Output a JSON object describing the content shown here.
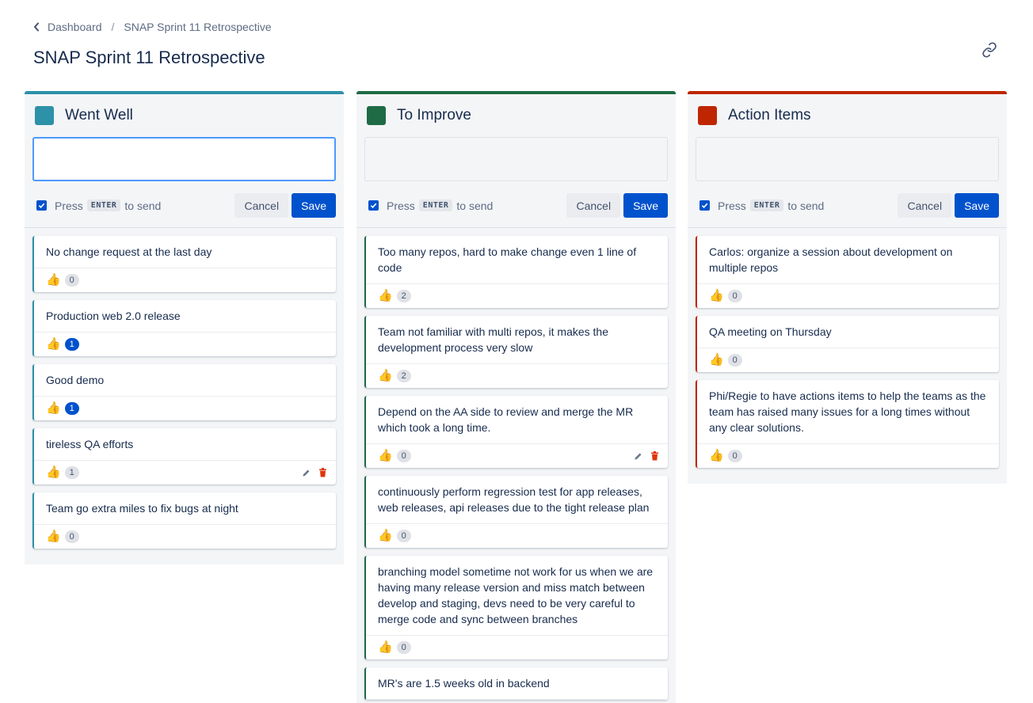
{
  "breadcrumb": {
    "parent": "Dashboard",
    "separator": "/",
    "current": "SNAP Sprint 11 Retrospective"
  },
  "page": {
    "title": "SNAP Sprint 11 Retrospective"
  },
  "composer": {
    "press": "Press",
    "key": "ENTER",
    "to_send": "to send",
    "cancel": "Cancel",
    "save": "Save"
  },
  "columns": [
    {
      "title": "Went Well",
      "color": "#2d91a8",
      "cards": [
        {
          "text": "No change request at the last day",
          "votes": "0"
        },
        {
          "text": "Production web 2.0 release",
          "votes": "1"
        },
        {
          "text": "Good demo",
          "votes": "1"
        },
        {
          "text": "tireless QA efforts",
          "votes": "1"
        },
        {
          "text": "Team go extra miles to fix bugs at night",
          "votes": "0"
        }
      ]
    },
    {
      "title": "To Improve",
      "color": "#1f6b45",
      "cards": [
        {
          "text": "Too many repos, hard to make change even 1 line of code",
          "votes": "2"
        },
        {
          "text": "Team not familiar with multi repos, it makes the development process very slow",
          "votes": "2"
        },
        {
          "text": "Depend on the AA side to review and merge the MR which took a long time.",
          "votes": "0"
        },
        {
          "text": "continuously perform regression test for app releases, web releases, api releases due to the tight release plan",
          "votes": "0"
        },
        {
          "text": "branching model sometime not work for us when we are having many release version and miss match between develop and staging, devs need to be very careful to merge code and sync between branches",
          "votes": "0"
        },
        {
          "text": "MR's are 1.5 weeks old in backend",
          "votes": ""
        }
      ]
    },
    {
      "title": "Action Items",
      "color": "#bf2600",
      "cards": [
        {
          "text": "Carlos: organize a session about development on multiple repos",
          "votes": "0"
        },
        {
          "text": "QA meeting on Thursday",
          "votes": "0"
        },
        {
          "text": "Phi/Regie to have actions items to help the teams as the team has raised many issues for a long times without any clear solutions.",
          "votes": "0"
        }
      ]
    }
  ],
  "icons": {
    "back": "chevron-left-icon",
    "link": "link-icon",
    "thumb": "thumbs-up-icon",
    "edit": "pencil-icon",
    "delete": "trash-icon",
    "checkbox": "checkbox-checked-icon"
  }
}
